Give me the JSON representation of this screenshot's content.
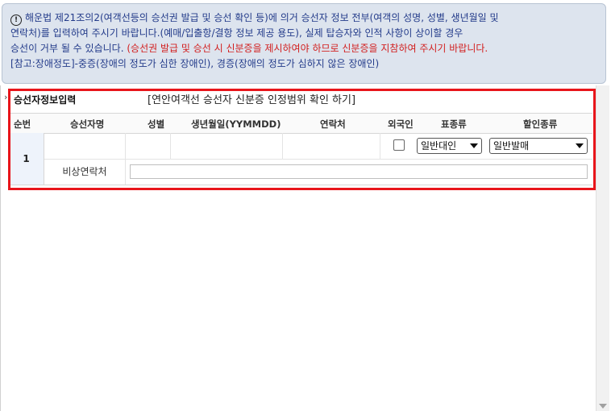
{
  "notice": {
    "line1": "해운법 제21조의2(여객선등의 승선권 발급 및 승선 확인 등)에 의거 승선자 정보 전부(여객의 성명, 성별, 생년월일 및",
    "line2": "연락처)를 입력하여 주시기 바랍니다.(예매/입출항/결항 정보 제공 용도), 실제 탑승자와 인적 사항이 상이할 경우",
    "line3_normal": "승선이 거부 될 수 있습니다.",
    "line3_red": "(승선권 발급 및 승선 시 신분증을 제시하여야 하므로 신분증을 지참하여 주시기 바랍니다.",
    "line4": "[참고:장애정도]-중증(장애의 정도가 심한 장애인), 경증(장애의 정도가 심하지 않은 장애인)",
    "icon": "alert-circle-icon"
  },
  "section": {
    "title": "승선자정보입력",
    "id_range_link": "[연안여객선 승선자 신분증 인정범위 확인 하기]"
  },
  "table": {
    "headers": {
      "seq": "순번",
      "name": "승선자명",
      "gender": "성별",
      "birth": "생년월일(YYMMDD)",
      "contact": "연락처",
      "foreigner": "외국인",
      "ticket_type": "표종류",
      "discount_type": "할인종류"
    },
    "rows": [
      {
        "seq": "1",
        "name": "",
        "gender": "",
        "birth": "",
        "contact": "",
        "foreigner_checked": false,
        "ticket_type": "일반대인",
        "discount_type": "일반발매",
        "emergency_label": "비상연락처",
        "emergency_value": ""
      }
    ]
  },
  "colors": {
    "highlight_frame": "#e8151b",
    "notice_bg": "#dde4ee",
    "notice_text": "#233b8a",
    "notice_red": "#d21f1f"
  }
}
